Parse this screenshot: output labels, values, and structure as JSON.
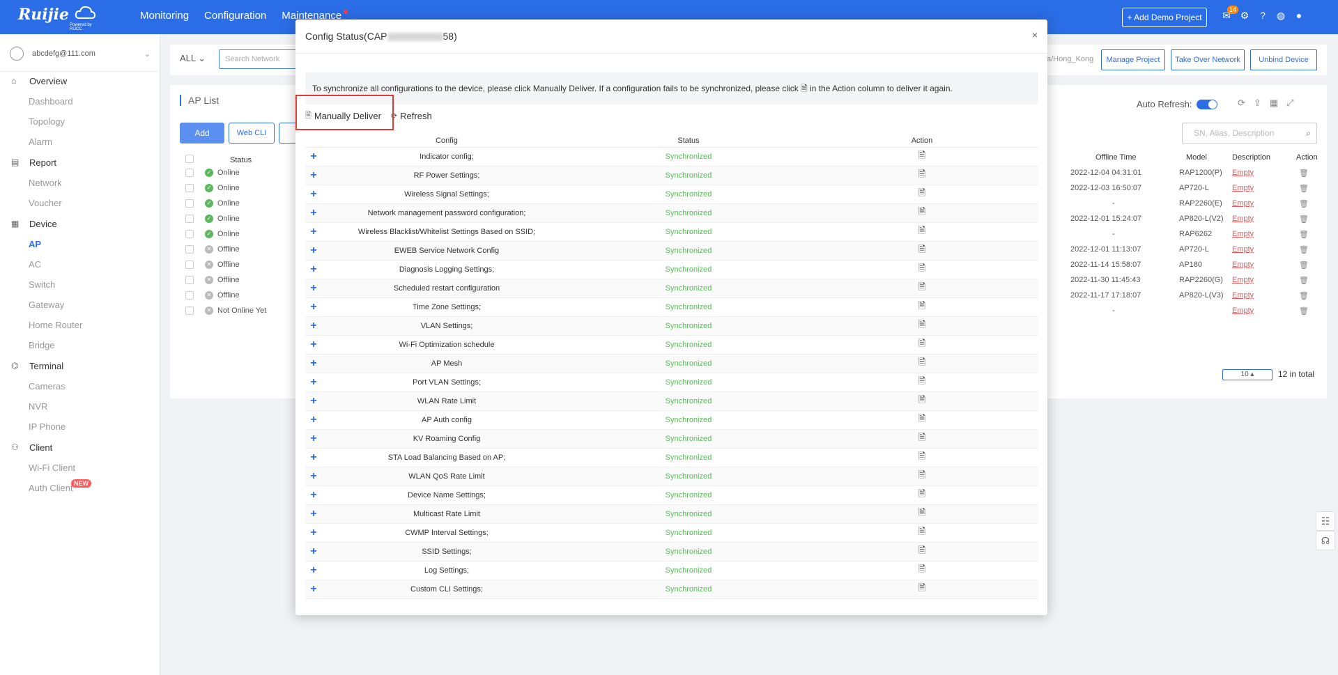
{
  "topbar": {
    "logo": "Ruijie",
    "logo_sub": "Powered by RIJCC",
    "nav": [
      "Monitoring",
      "Configuration",
      "Maintenance"
    ],
    "demo_button": "+ Add Demo Project",
    "badge_count": "14"
  },
  "sidebar": {
    "account": "abcdefg@111.com",
    "groups": [
      {
        "label": "Overview",
        "icon": "home-icon",
        "items": [
          "Dashboard",
          "Topology",
          "Alarm"
        ]
      },
      {
        "label": "Report",
        "icon": "report-icon",
        "items": [
          "Network",
          "Voucher"
        ]
      },
      {
        "label": "Device",
        "icon": "device-icon",
        "items": [
          "AP",
          "AC",
          "Switch",
          "Gateway",
          "Home Router",
          "Bridge"
        ]
      },
      {
        "label": "Terminal",
        "icon": "terminal-icon",
        "items": [
          "Cameras",
          "NVR",
          "IP Phone"
        ]
      },
      {
        "label": "Client",
        "icon": "client-icon",
        "items": [
          "Wi-Fi Client",
          "Auth Client"
        ]
      }
    ],
    "active_item": "AP",
    "new_tag": "NEW"
  },
  "toolbar": {
    "scope": "ALL",
    "search_placeholder": "Search Network",
    "timezone": "a/Hong_Kong",
    "buttons": [
      "Manage Project",
      "Take Over Network",
      "Unbind Device"
    ]
  },
  "ap_list": {
    "title": "AP List",
    "add": "Add",
    "web_cli": "Web CLI",
    "auto_refresh": "Auto Refresh:",
    "search_placeholder": "SN, Alias, Description",
    "left_header": "Status",
    "right_headers": [
      "Offline Time",
      "Model",
      "Description",
      "Action"
    ],
    "rows": [
      {
        "status": "Online",
        "offline": "2022-12-04 04:31:01",
        "model": "RAP1200(P)",
        "desc": "Empty"
      },
      {
        "status": "Online",
        "offline": "2022-12-03 16:50:07",
        "model": "AP720-L",
        "desc": "Empty"
      },
      {
        "status": "Online",
        "offline": "-",
        "model": "RAP2260(E)",
        "desc": "Empty"
      },
      {
        "status": "Online",
        "offline": "2022-12-01 15:24:07",
        "model": "AP820-L(V2)",
        "desc": "Empty"
      },
      {
        "status": "Online",
        "offline": "-",
        "model": "RAP6262",
        "desc": "Empty"
      },
      {
        "status": "Offline",
        "offline": "2022-12-01 11:13:07",
        "model": "AP720-L",
        "desc": "Empty"
      },
      {
        "status": "Offline",
        "offline": "2022-11-14 15:58:07",
        "model": "AP180",
        "desc": "Empty"
      },
      {
        "status": "Offline",
        "offline": "2022-11-30 11:45:43",
        "model": "RAP2260(G)",
        "desc": "Empty"
      },
      {
        "status": "Offline",
        "offline": "2022-11-17 17:18:07",
        "model": "AP820-L(V3)",
        "desc": "Empty"
      },
      {
        "status": "Not Online Yet",
        "offline": "-",
        "model": "",
        "desc": "Empty"
      }
    ],
    "page_size": "10",
    "total": "12 in total"
  },
  "modal": {
    "title_prefix": "Config Status(CAP",
    "title_suffix": "58)",
    "close": "×",
    "info_text": "To synchronize all configurations to the device, please click Manually Deliver. If a configuration fails to be synchronized, please click",
    "info_text_end": "in the Action column to deliver it again.",
    "manual_deliver": "Manually Deliver",
    "refresh": "Refresh",
    "headers": [
      "Config",
      "Status",
      "Action"
    ],
    "rows": [
      {
        "config": "Indicator config;",
        "status": "Synchronized"
      },
      {
        "config": "RF Power Settings;",
        "status": "Synchronized"
      },
      {
        "config": "Wireless Signal Settings;",
        "status": "Synchronized"
      },
      {
        "config": "Network management password configuration;",
        "status": "Synchronized"
      },
      {
        "config": "Wireless Blacklist/Whitelist Settings Based on SSID;",
        "status": "Synchronized"
      },
      {
        "config": "EWEB Service Network Config",
        "status": "Synchronized"
      },
      {
        "config": "Diagnosis Logging Settings;",
        "status": "Synchronized"
      },
      {
        "config": "Scheduled restart configuration",
        "status": "Synchronized"
      },
      {
        "config": "Time Zone Settings;",
        "status": "Synchronized"
      },
      {
        "config": "VLAN Settings;",
        "status": "Synchronized"
      },
      {
        "config": "Wi-Fi Optimization schedule",
        "status": "Synchronized"
      },
      {
        "config": "AP Mesh",
        "status": "Synchronized"
      },
      {
        "config": "Port VLAN Settings;",
        "status": "Synchronized"
      },
      {
        "config": "WLAN Rate Limit",
        "status": "Synchronized"
      },
      {
        "config": "AP Auth config",
        "status": "Synchronized"
      },
      {
        "config": "KV Roaming Config",
        "status": "Synchronized"
      },
      {
        "config": "STA Load Balancing Based on AP;",
        "status": "Synchronized"
      },
      {
        "config": "WLAN QoS Rate Limit",
        "status": "Synchronized"
      },
      {
        "config": "Device Name Settings;",
        "status": "Synchronized"
      },
      {
        "config": "Multicast Rate Limit",
        "status": "Synchronized"
      },
      {
        "config": "CWMP Interval Settings;",
        "status": "Synchronized"
      },
      {
        "config": "SSID Settings;",
        "status": "Synchronized"
      },
      {
        "config": "Log Settings;",
        "status": "Synchronized"
      },
      {
        "config": "Custom CLI Settings;",
        "status": "Synchronized"
      }
    ]
  },
  "colors": {
    "brand": "#2b6de6",
    "success": "#5cb85c",
    "danger": "#e53935"
  }
}
